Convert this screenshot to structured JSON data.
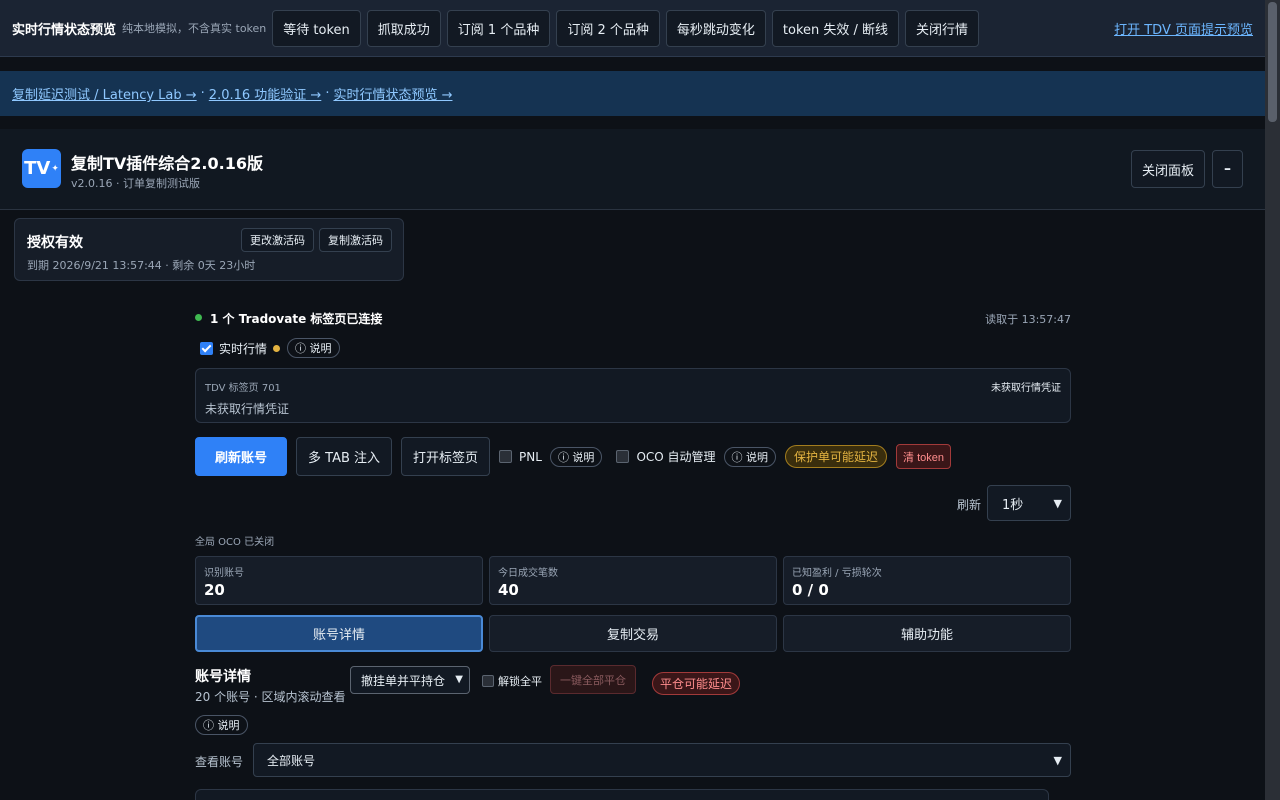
{
  "topbar": {
    "title": "实时行情状态预览",
    "subtitle": "纯本地模拟，不含真实 token",
    "buttons": [
      "等待 token",
      "抓取成功",
      "订阅 1 个品种",
      "订阅 2 个品种",
      "每秒跳动变化",
      "token 失效 / 断线",
      "关闭行情"
    ],
    "open_link": "打开 TDV 页面提示预览"
  },
  "linkbar": {
    "links": [
      "复制延迟测试 / Latency Lab →",
      "2.0.16 功能验证 →",
      "实时行情状态预览 →"
    ],
    "separator": "·"
  },
  "header": {
    "logo_text": "TV",
    "title": "复制TV插件综合2.0.16版",
    "version": "v2.0.16 · 订单复制测试版",
    "close_label": "关闭面板",
    "min_label": "–"
  },
  "license": {
    "status": "授权有效",
    "change_label": "更改激活码",
    "copy_label": "复制激活码",
    "expiry": "到期 2026/9/21 13:57:44 · 剩余 0天 23小时"
  },
  "connection": {
    "text": "1 个 Tradovate 标签页已连接",
    "read_time": "读取于 13:57:47"
  },
  "realtime": {
    "label": "实时行情",
    "help": "ⓘ 说明",
    "checked": true
  },
  "tdv": {
    "tab_name": "TDV 标签页 701",
    "status": "未获取行情凭证",
    "message": "未获取行情凭证"
  },
  "actions": {
    "refresh_account": "刷新账号",
    "multi_tab": "多 TAB 注入",
    "open_tab": "打开标签页",
    "pnl_label": "PNL",
    "pnl_help": "ⓘ 说明",
    "oco_label": "OCO 自动管理",
    "oco_help": "ⓘ 说明",
    "protect_badge": "保护单可能延迟",
    "clear_token": "清 token"
  },
  "refresh": {
    "label": "刷新",
    "value": "1秒"
  },
  "oco_status": "全局 OCO 已关闭",
  "stats": [
    {
      "label": "识别账号",
      "value": "20"
    },
    {
      "label": "今日成交笔数",
      "value": "40"
    },
    {
      "label": "已知盈利 / 亏损轮次",
      "value": "0 / 0"
    }
  ],
  "tabs": [
    "账号详情",
    "复制交易",
    "辅助功能"
  ],
  "details": {
    "title": "账号详情",
    "subtitle": "20 个账号 · 区域内滚动查看",
    "mode_value": "撤挂单并平持仓",
    "unlock_label": "解锁全平",
    "flat_all": "一键全部平仓",
    "flat_warn": "平仓可能延迟",
    "help": "ⓘ 说明",
    "account_label": "查看账号",
    "account_value": "全部账号"
  },
  "colors": {
    "accent": "#2f81f7",
    "connected": "#3fb950",
    "warning": "#e3b341",
    "danger": "#ff8d8d"
  }
}
